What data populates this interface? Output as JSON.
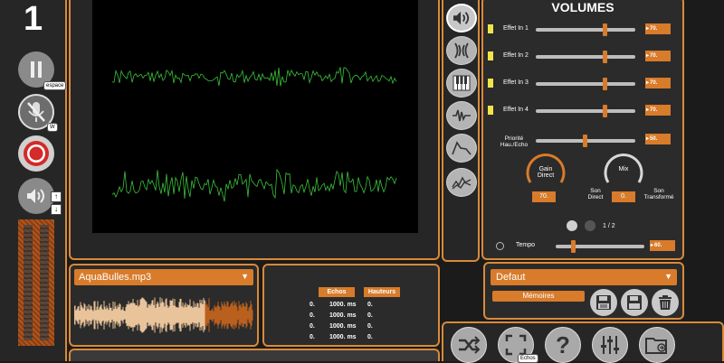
{
  "left": {
    "track_number": "1",
    "pause_shortcut": "espace",
    "mute_shortcut": "W"
  },
  "volumes": {
    "title": "VOLUMES",
    "effects": [
      {
        "label": "Effet In 1",
        "value": "70.",
        "level": 0.7
      },
      {
        "label": "Effet In 2",
        "value": "70.",
        "level": 0.7
      },
      {
        "label": "Effet In 3",
        "value": "70.",
        "level": 0.7
      },
      {
        "label": "Effet In 4",
        "value": "70.",
        "level": 0.7
      }
    ],
    "priority_label": "Priorité\nHau./Echo",
    "priority_value": "50.",
    "priority_level": 0.5,
    "gain_label": "Gain\nDirect",
    "gain_value": "70.",
    "mix_label": "Mix",
    "mix_value": "0.",
    "son_direct": "Son\nDirect",
    "son_transforme": "Son\nTransformé",
    "page": "1 / 2",
    "tempo_label": "Tempo",
    "tempo_value": "60.",
    "tempo_level": 0.2
  },
  "presets": {
    "selected": "Defaut",
    "memories_label": "Mémoires"
  },
  "file": {
    "selected": "AquaBulles.mp3"
  },
  "echos": {
    "header_echos": "Echos",
    "header_hauteurs": "Hauteurs",
    "rows": [
      {
        "a": "0.",
        "b": "1000. ms",
        "c": "0."
      },
      {
        "a": "0.",
        "b": "1000. ms",
        "c": "0."
      },
      {
        "a": "0.",
        "b": "1000. ms",
        "c": "0."
      },
      {
        "a": "0.",
        "b": "1000. ms",
        "c": "0."
      }
    ]
  },
  "toolbar": {
    "fullscreen_tooltip": "Echos"
  },
  "colors": {
    "accent": "#d98a3a",
    "waveform": "#39c23a",
    "led": "#f2e34c"
  }
}
